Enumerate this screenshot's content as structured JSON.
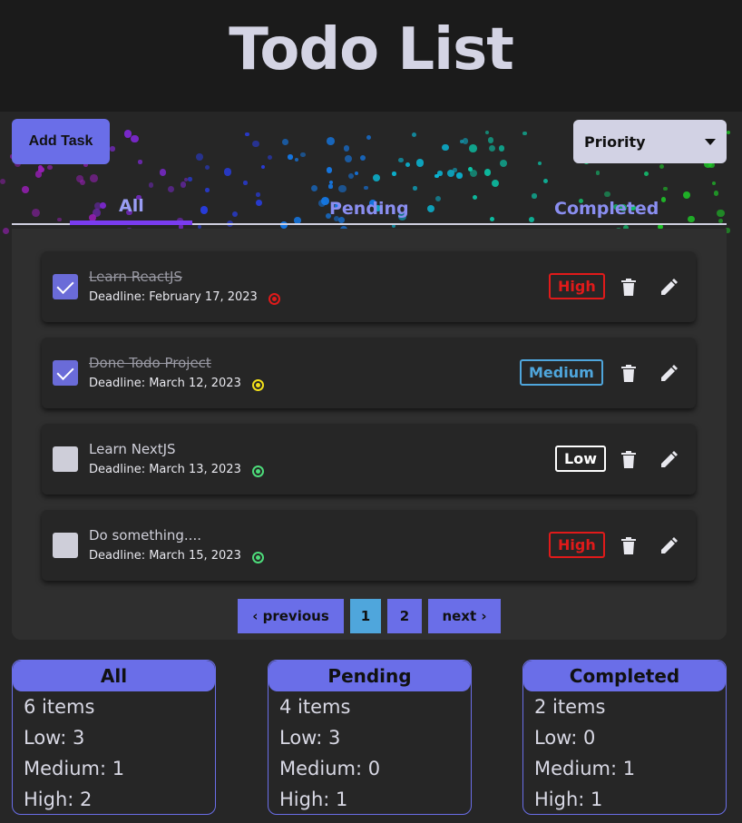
{
  "header": {
    "title": "Todo List"
  },
  "toolbar": {
    "add_label": "Add Task",
    "priority_value": "Priority"
  },
  "tabs": {
    "all": "All",
    "pending": "Pending",
    "completed": "Completed"
  },
  "tasks": [
    {
      "title": "Learn ReactJS",
      "deadline": "Deadline: February 17, 2023",
      "done": true,
      "priority": "High",
      "priority_color": "#e01a1a",
      "status_color": "#e01a1a"
    },
    {
      "title": "Done Todo Project",
      "deadline": "Deadline: March 12, 2023",
      "done": true,
      "priority": "Medium",
      "priority_color": "#4fa6dc",
      "status_color": "#f2e01a"
    },
    {
      "title": "Learn NextJS",
      "deadline": "Deadline: March 13, 2023",
      "done": false,
      "priority": "Low",
      "priority_color": "#ffffff",
      "status_color": "#4ddc7a"
    },
    {
      "title": "Do something....",
      "deadline": "Deadline: March 15, 2023",
      "done": false,
      "priority": "High",
      "priority_color": "#e01a1a",
      "status_color": "#4ddc7a"
    }
  ],
  "pagination": {
    "prev": "‹ previous",
    "pages": [
      "1",
      "2"
    ],
    "current": "1",
    "next": "next ›"
  },
  "stats": {
    "all": {
      "title": "All",
      "items": "6 items",
      "low": "Low: 3",
      "medium": "Medium: 1",
      "high": "High: 2"
    },
    "pending": {
      "title": "Pending",
      "items": "4 items",
      "low": "Low: 3",
      "medium": "Medium: 0",
      "high": "High: 1"
    },
    "completed": {
      "title": "Completed",
      "items": "2 items",
      "low": "Low: 0",
      "medium": "Medium: 1",
      "high": "High: 1"
    }
  },
  "colors": {
    "accent": "#6a6ee8",
    "tab_active": "#7a3cf0",
    "background": "#262626"
  }
}
